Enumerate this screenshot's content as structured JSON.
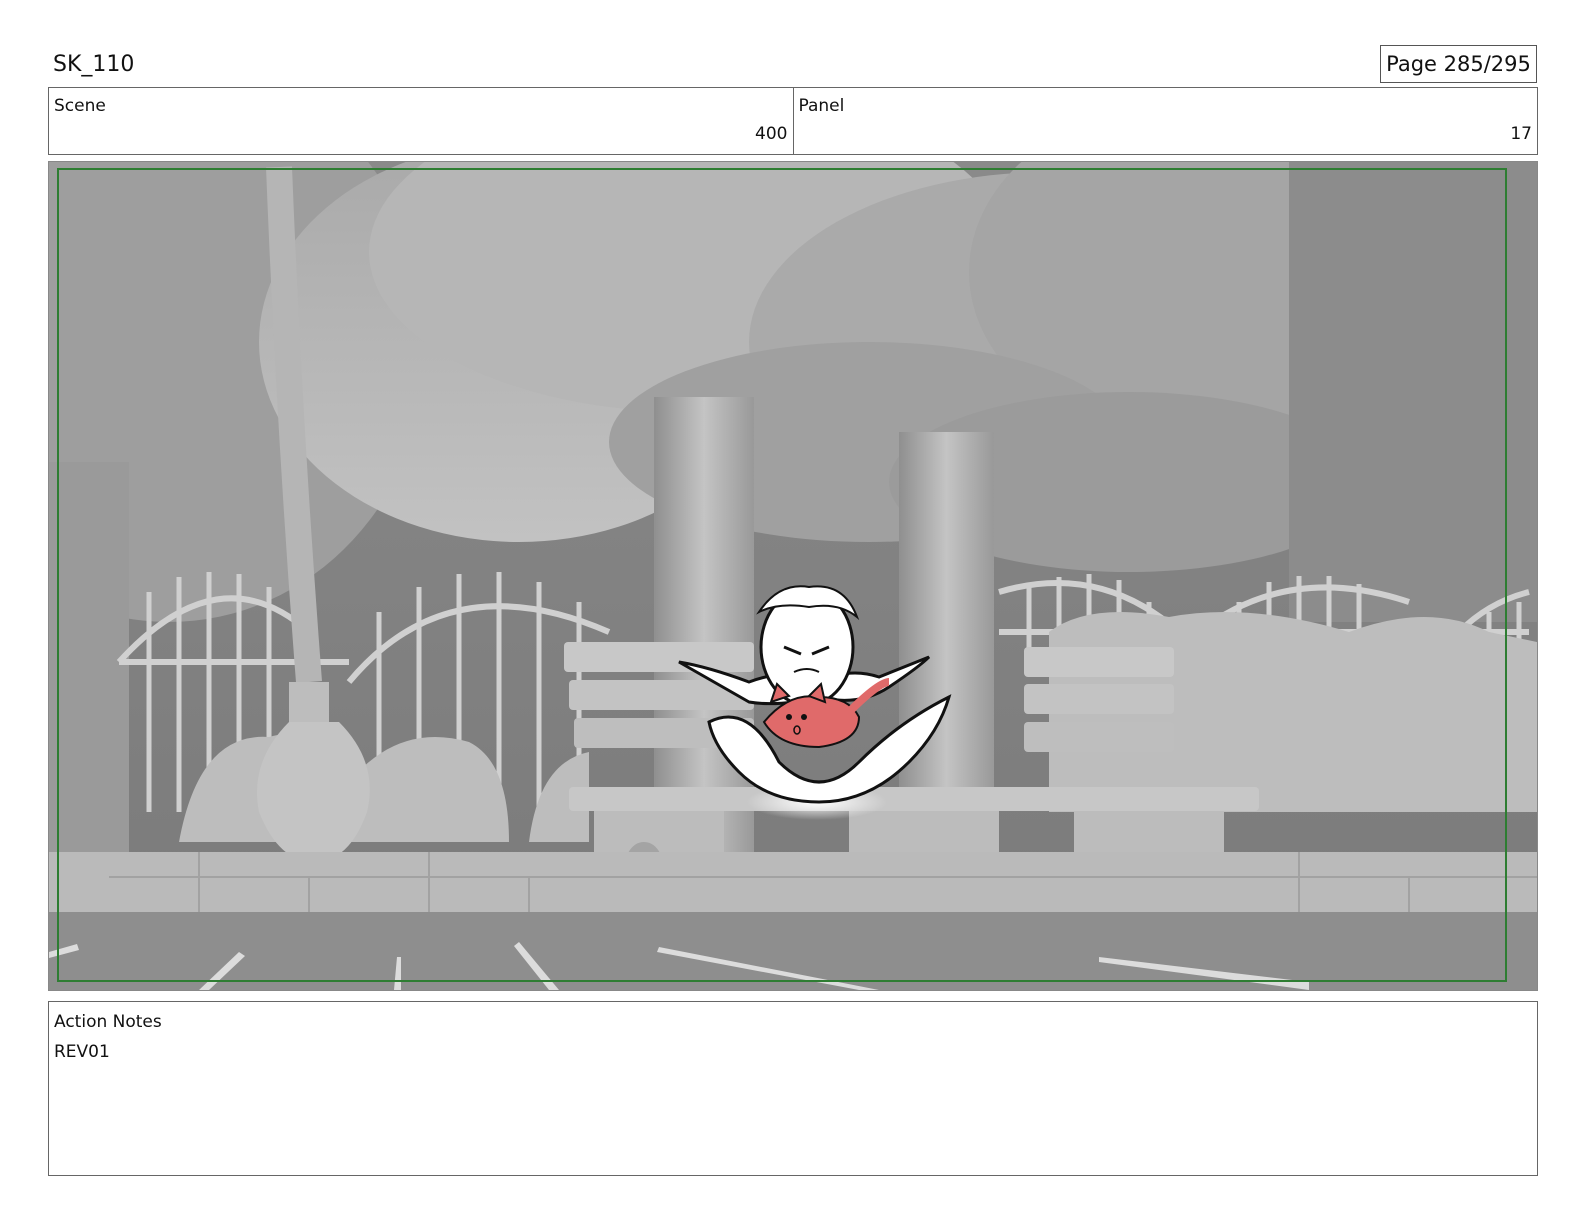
{
  "header": {
    "project": "SK_110",
    "page": "Page 285/295"
  },
  "info": {
    "scene_label": "Scene",
    "scene_value": "400",
    "panel_label": "Panel",
    "panel_value": "17"
  },
  "notes": {
    "label": "Action Notes",
    "text": "REV01"
  },
  "colors": {
    "safe_frame": "#2e7d32",
    "cat": "#e06a6a"
  }
}
